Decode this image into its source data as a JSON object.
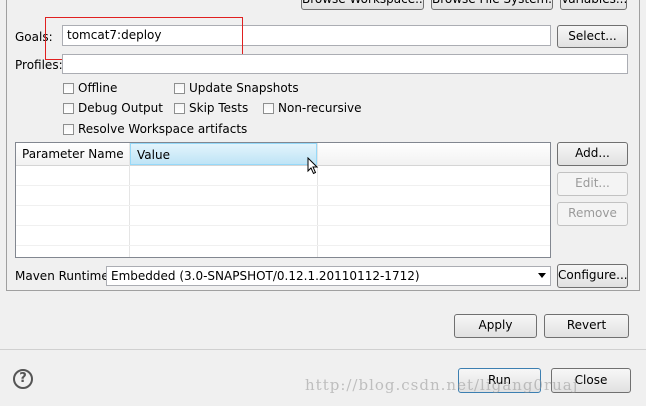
{
  "top_buttons": {
    "browse_workspace": "Browse Workspace...",
    "browse_file_system": "Browse File System...",
    "variables": "Variables..."
  },
  "goals": {
    "label": "Goals:",
    "value": "tomcat7:deploy",
    "select_button": "Select..."
  },
  "profiles": {
    "label": "Profiles:",
    "value": ""
  },
  "options": {
    "offline": "Offline",
    "update_snapshots": "Update Snapshots",
    "debug_output": "Debug Output",
    "skip_tests": "Skip Tests",
    "non_recursive": "Non-recursive",
    "resolve_workspace": "Resolve Workspace artifacts"
  },
  "parameters": {
    "columns": [
      "Parameter Name",
      "Value"
    ],
    "add_button": "Add...",
    "edit_button": "Edit...",
    "remove_button": "Remove"
  },
  "maven_runtime": {
    "label": "Maven Runtime:",
    "selected": "Embedded (3.0-SNAPSHOT/0.12.1.20110112-1712)",
    "configure_button": "Configure..."
  },
  "apply_button": "Apply",
  "revert_button": "Revert",
  "run_button": "Run",
  "close_button": "Close",
  "watermark": "http://blog.csdn.net/ligang0ruaj",
  "colors": {
    "highlight_box": "#e02020",
    "header_hover": "#cce8f7"
  }
}
